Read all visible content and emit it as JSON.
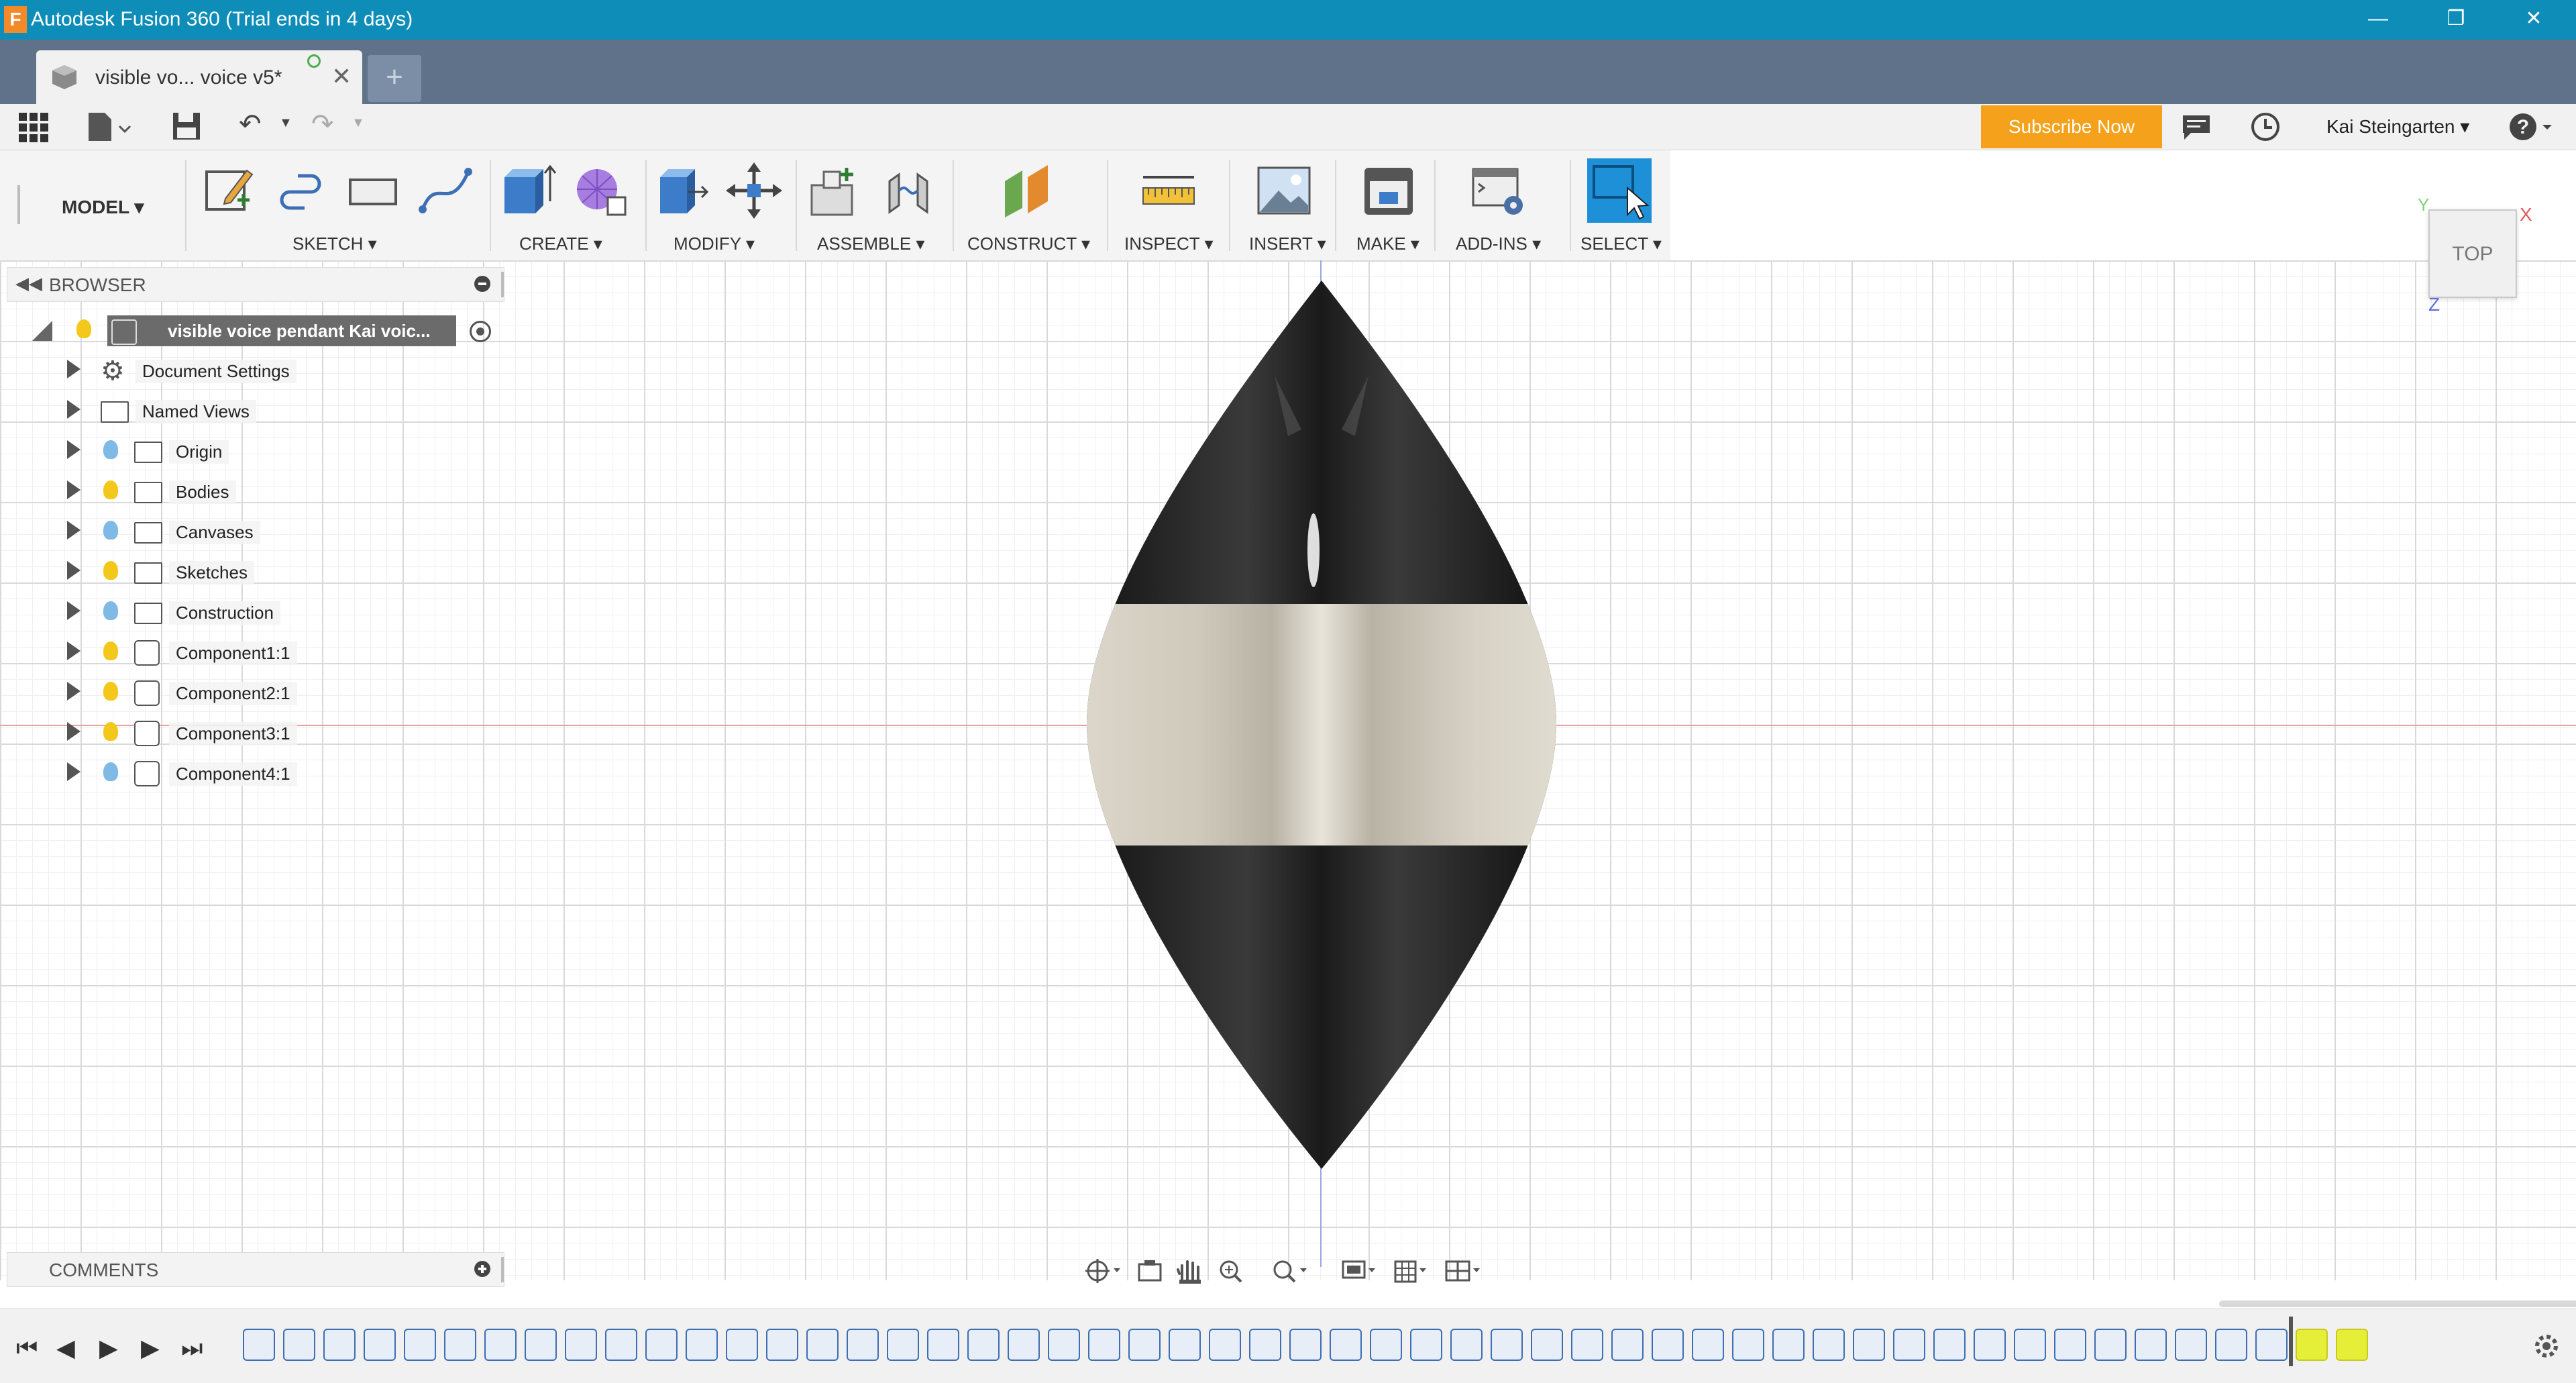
{
  "window": {
    "title": "Autodesk Fusion 360 (Trial ends in 4 days)",
    "app_logo": "F"
  },
  "tab": {
    "label": "visible vo... voice v5*"
  },
  "quick_access": {
    "subscribe_label": "Subscribe Now",
    "user_name": "Kai Steingarten ▾"
  },
  "toolbar": {
    "workspace": "MODEL ▾",
    "groups": {
      "sketch": "SKETCH ▾",
      "create": "CREATE ▾",
      "modify": "MODIFY ▾",
      "assemble": "ASSEMBLE ▾",
      "construct": "CONSTRUCT ▾",
      "inspect": "INSPECT ▾",
      "insert": "INSERT ▾",
      "make": "MAKE ▾",
      "addins": "ADD-INS ▾",
      "select": "SELECT ▾"
    }
  },
  "browser": {
    "title": "BROWSER",
    "root": "visible voice pendant Kai voic...",
    "items": [
      {
        "label": "Document Settings",
        "icon": "gear-icon"
      },
      {
        "label": "Named Views",
        "icon": "folder-icon"
      },
      {
        "label": "Origin",
        "icon": "folder-icon",
        "bulb": "blue"
      },
      {
        "label": "Bodies",
        "icon": "folder-icon",
        "bulb": "yellow"
      },
      {
        "label": "Canvases",
        "icon": "folder-icon",
        "bulb": "blue"
      },
      {
        "label": "Sketches",
        "icon": "folder-icon",
        "bulb": "yellow"
      },
      {
        "label": "Construction",
        "icon": "folder-icon",
        "bulb": "blue"
      },
      {
        "label": "Component1:1",
        "icon": "component-icon",
        "bulb": "yellow"
      },
      {
        "label": "Component2:1",
        "icon": "component-icon",
        "bulb": "yellow"
      },
      {
        "label": "Component3:1",
        "icon": "component-icon",
        "bulb": "yellow"
      },
      {
        "label": "Component4:1",
        "icon": "component-icon",
        "bulb": "blue"
      }
    ]
  },
  "comments": {
    "title": "COMMENTS"
  },
  "viewcube": {
    "face": "TOP",
    "axis_x": "X",
    "axis_y": "Y",
    "axis_z": "Z"
  },
  "colors": {
    "titlebar": "#0e8db8",
    "tabstrip": "#5f7289",
    "subscribe": "#f5a11b",
    "select_active": "#1e90d8",
    "bulb_yellow": "#f4c81b",
    "bulb_blue": "#7fb9e6"
  }
}
